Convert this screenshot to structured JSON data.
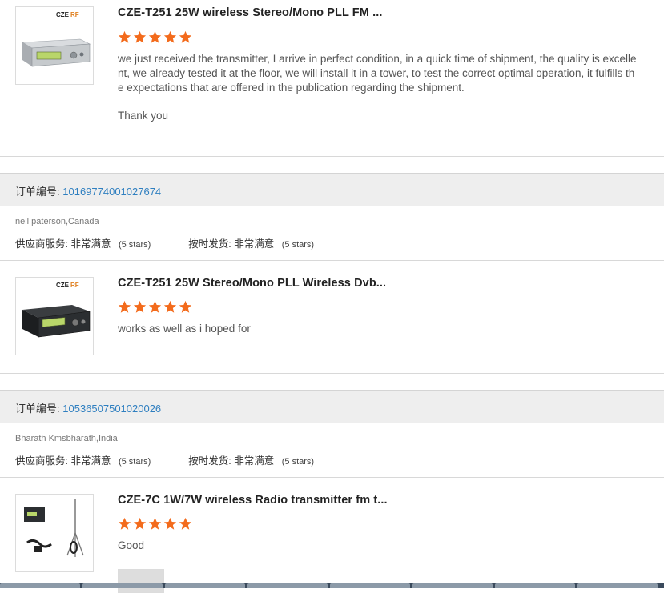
{
  "reviews": [
    {
      "product_title": "CZE-T251 25W wireless Stereo/Mono PLL FM ...",
      "stars": 5,
      "text": "we just received the transmitter, I arrive in perfect condition, in a quick time of shipment, the quality is excellent, we already tested it at the floor, we will install it in a tower, to test the correct optimal operation, it fulfills the expectations that are offered in the publication regarding the shipment.",
      "extra_text": "Thank you",
      "brand_label": "CZERF"
    },
    {
      "order_label": "订单编号:",
      "order_number": "10169774001027674",
      "buyer": "neil paterson,Canada",
      "supplier_service_label": "供应商服务:",
      "supplier_service_value": "非常满意",
      "supplier_service_stars": "(5 stars)",
      "on_time_label": "按时发货:",
      "on_time_value": "非常满意",
      "on_time_stars": "(5 stars)",
      "product_title": "CZE-T251 25W Stereo/Mono PLL Wireless Dvb...",
      "stars": 5,
      "text": "works as well as i hoped for",
      "brand_label": "CZERF"
    },
    {
      "order_label": "订单编号:",
      "order_number": "10536507501020026",
      "buyer": "Bharath Kmsbharath,India",
      "supplier_service_label": "供应商服务:",
      "supplier_service_value": "非常满意",
      "supplier_service_stars": "(5 stars)",
      "on_time_label": "按时发货:",
      "on_time_value": "非常满意",
      "on_time_stars": "(5 stars)",
      "product_title": "CZE-7C 1W/7W wireless Radio transmitter fm t...",
      "stars": 5,
      "text": "Good"
    }
  ],
  "colors": {
    "star": "#f36b1c",
    "order_number": "#2f7fc0",
    "order_bar": "#eeeeee"
  },
  "icons": [
    "star-icon",
    "product-thumbnail"
  ]
}
